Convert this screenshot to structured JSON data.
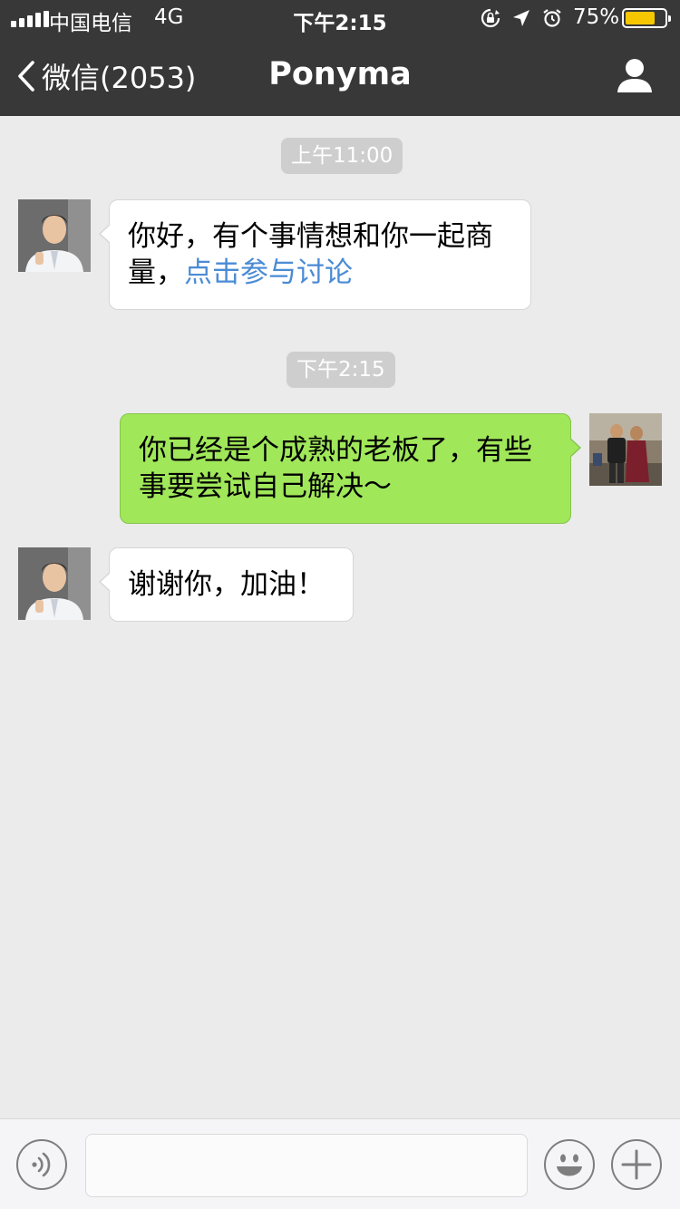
{
  "status_bar": {
    "carrier": "中国电信",
    "network": "4G",
    "time": "下午2:15",
    "battery_percent": "75%",
    "battery_level": 0.75,
    "battery_color": "#f6c700",
    "icons": [
      "signal-icon",
      "orientation-lock-icon",
      "location-arrow-icon",
      "alarm-clock-icon",
      "battery-icon"
    ]
  },
  "nav": {
    "back_label": "微信(2053)",
    "title": "Ponyma",
    "right_icon": "person-icon"
  },
  "messages": [
    {
      "type": "timestamp",
      "text": "上午11:00"
    },
    {
      "type": "received",
      "avatar": "ponyma-avatar",
      "text": "你好，有个事情想和你一起商量，",
      "link_text": "点击参与讨论"
    },
    {
      "type": "timestamp",
      "text": "下午2:15"
    },
    {
      "type": "sent",
      "avatar": "my-avatar",
      "text": "你已经是个成熟的老板了，有些事要尝试自己解决～"
    },
    {
      "type": "received",
      "avatar": "ponyma-avatar",
      "text": "谢谢你，加油！"
    }
  ],
  "input_bar": {
    "left_icon": "voice-icon",
    "input_value": "",
    "emoji_icon": "emoji-icon",
    "add_icon": "plus-icon"
  },
  "colors": {
    "nav_bg": "#383838",
    "chat_bg": "#ebebeb",
    "sent_bubble": "#a0e75a",
    "received_bubble": "#ffffff",
    "link": "#4a8bd6",
    "timestamp_bg": "#cecece"
  }
}
